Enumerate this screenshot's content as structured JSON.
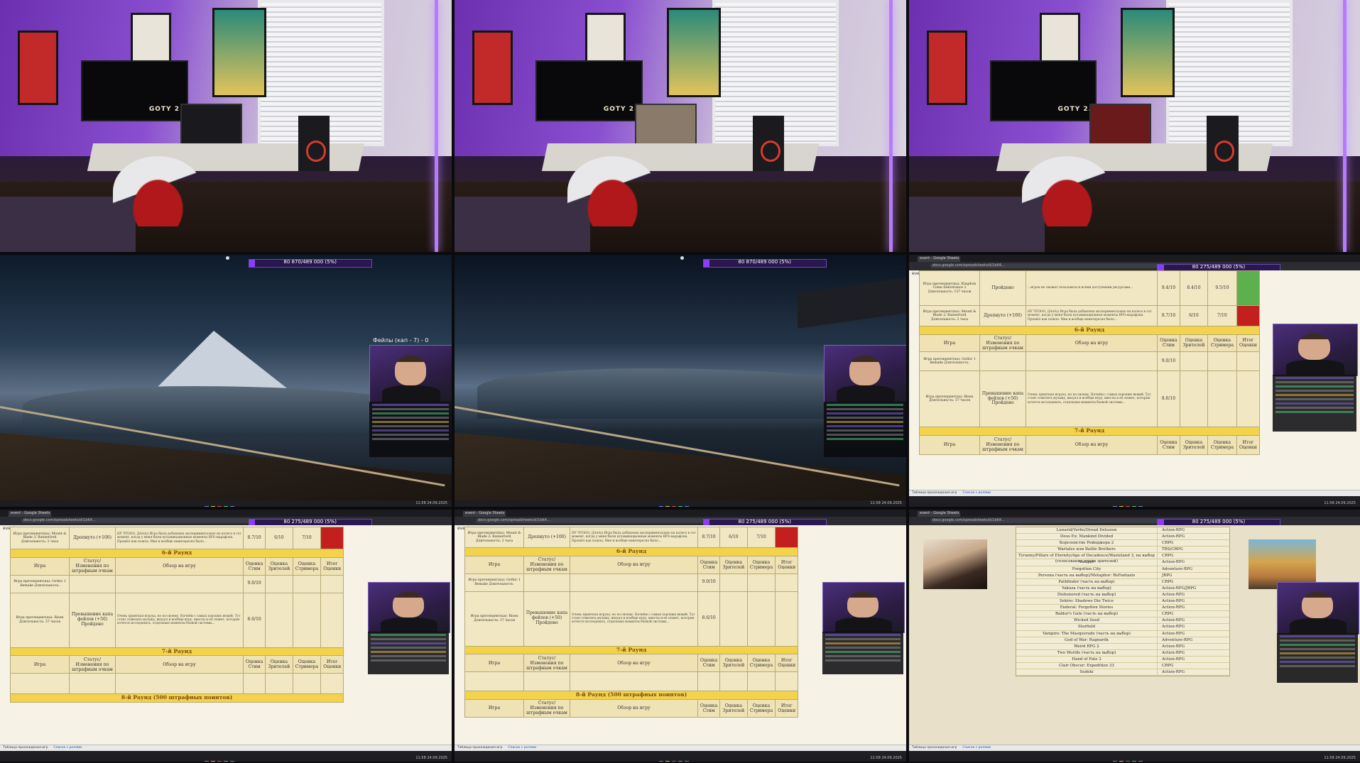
{
  "room": {
    "tv_label": "GOTY 2.0"
  },
  "hud": {
    "tile4": {
      "text": "80 870/489 000 (5%)",
      "fill_fraction": 0.05
    },
    "tile5": {
      "text": "80 870/489 000 (5%)",
      "fill_fraction": 0.05
    },
    "tile6": {
      "text": "80 275/489 000 (5%)",
      "fill_fraction": 0.05
    },
    "tile7": {
      "text": "80 275/489 000 (5%)",
      "fill_fraction": 0.05
    },
    "tile8": {
      "text": "80 275/489 000 (5%)",
      "fill_fraction": 0.05
    },
    "tile9": {
      "text": "80 275/489 000 (5%)",
      "fill_fraction": 0.05
    }
  },
  "overlay": {
    "fails": "Фейлы (кап - 7) - 0"
  },
  "browser": {
    "tab_label": "event - Google Sheets",
    "url": "docs.google.com/spreadsheets/d/1bK4...",
    "event_label": "event"
  },
  "sheet": {
    "headers": {
      "game": "Игра",
      "status": "Статус/Изменения по штрафным очкам",
      "review": "Обзор на игру",
      "steam": "Оценка Стим",
      "viewers": "Оценка Зрителей",
      "streamer": "Оценка Стримера",
      "total": "Итог Оценки"
    },
    "rounds": {
      "r6": "6-й Раунд",
      "r7": "7-й Раунд",
      "r8": "8-й Раунд (500 штрафных поинтов)"
    },
    "rows": {
      "kcd_name": "Игра претендент(ка): Kingdom Come Deliverance 2 Длительность: 137 часов",
      "kcd_status": "Пройдено",
      "kcd_steam": "9.4/10",
      "kcd_viewers": "8.4/10",
      "kcd_streamer": "9.5/10",
      "mb_name": "Игра претендент(ка): Mount & Blade 2: Bannerlord Длительность: 2 часа",
      "mb_status": "Дропнуто (+100)",
      "mb_steam": "8.7/10",
      "mb_viewers": "6/10",
      "mb_streamer": "7/10",
      "gothic_name": "Игра претендент(ка): Gothic 1 Remake Длительность:",
      "gothic_steam": "9.0/10",
      "risen_name": "Игра претендент(ка): Risen Длительность: 37 часов",
      "risen_status": "Превышение капа фейлов (+50) Пройдено",
      "risen_steam": "8.6/10"
    },
    "reviews": {
      "top": "…игрок не сможет пользоваться всеми доступными ресурсами…",
      "mb": "НУ ЧТООО, ДААА)) Игра была добавлена экспериментально на колесо в тот момент, когда у меня были кульминационные моменты RPG-марафона. Прошёл как пошла. Мне и вообще неинтересно было…",
      "risen": "Очень приятная игруха, но по-своему. Начнём с самых хороших вещей. Тут стоит отметить музыку, визуал и вообще игру, квесты и её сюжет, которые хочется исследовать, отдельные моменты боевой системы…"
    },
    "sheet_tabs": [
      "Таблица прохождения игр",
      "Список с ролями"
    ],
    "sheet_tab_active": "Список с ролями"
  },
  "list": {
    "items": [
      {
        "title": "Lunarid/Verbo/Dread Delusion",
        "genre": "Action-RPG"
      },
      {
        "title": "Deus Ex: Mankind Divided",
        "genre": "Action-RPG"
      },
      {
        "title": "Королевство Рейнджера 2",
        "genre": "CRPG"
      },
      {
        "title": "Wartales или Battle Brothers",
        "genre": "TBS/CRPG"
      },
      {
        "title": "Tyranny/Pillars of Eternity/Age of Decadence/Wasteland 3, на выбор (голосование среди зрителей)",
        "genre": "CRPG"
      },
      {
        "title": "Vampyr",
        "genre": "Action-RPG"
      },
      {
        "title": "Forgotten City",
        "genre": "Adventure-RPG"
      },
      {
        "title": "Persona (часть на выбор)/Metaphor: ReFantazio",
        "genre": "JRPG"
      },
      {
        "title": "Pathfinder (часть на выбор)",
        "genre": "CRPG"
      },
      {
        "title": "Yakuza (часть на выбор)",
        "genre": "Action-RPG/JRPG"
      },
      {
        "title": "Dishonored (часть на выбор)",
        "genre": "Action-RPG"
      },
      {
        "title": "Sekiro: Shadows Die Twice",
        "genre": "Action-RPG"
      },
      {
        "title": "Enderal: Forgotten Stories",
        "genre": "Action-RPG"
      },
      {
        "title": "Baldur's Gate (часть на выбор)",
        "genre": "CRPG"
      },
      {
        "title": "Wicked Seed",
        "genre": "Action-RPG"
      },
      {
        "title": "Starfield",
        "genre": "Action-RPG"
      },
      {
        "title": "Vampire: The Masquerade (часть на выбор)",
        "genre": "Action-RPG"
      },
      {
        "title": "God of War: Ragnarök",
        "genre": "Adventure-RPG"
      },
      {
        "title": "Weird RPG 2",
        "genre": "Action-RPG"
      },
      {
        "title": "Two Worlds (часть на выбор)",
        "genre": "Action-RPG"
      },
      {
        "title": "Hand of Fate 2",
        "genre": "Action-RPG"
      },
      {
        "title": "Clair Obscur: Expedition 33",
        "genre": "CRPG"
      },
      {
        "title": "Sudeki",
        "genre": "Action-RPG"
      }
    ]
  },
  "taskbar": {
    "clock": "11:58 24.09.2025"
  },
  "colors": {
    "accent": "#8b3cff",
    "round_header": "#f3d34a",
    "sheet_bg": "#f1e7c2"
  }
}
